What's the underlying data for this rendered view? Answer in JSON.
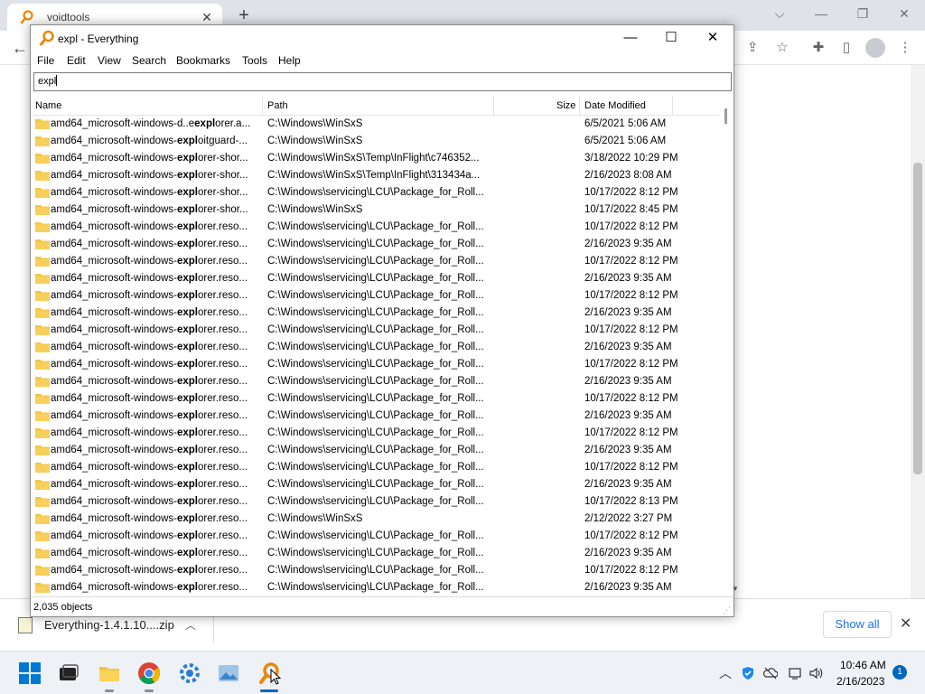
{
  "browser": {
    "tab_title": "voidtools",
    "tab_close": "✕",
    "new_tab": "+",
    "window_controls": {
      "dropdown": "⌵",
      "minimize": "—",
      "restore": "❐",
      "close": "✕"
    },
    "back": "←",
    "toolbar_icons": {
      "share": "⇪",
      "star": "☆",
      "puzzle": "✚",
      "sidebar": "▯",
      "menu": "⋮"
    }
  },
  "download_bar": {
    "file_name": "Everything-1.4.1.10....zip",
    "chevron": "︿",
    "show_all": "Show all",
    "close": "✕"
  },
  "everything": {
    "title": "expl - Everything",
    "controls": {
      "minimize": "—",
      "maximize": "☐",
      "close": "✕"
    },
    "menu": [
      "File",
      "Edit",
      "View",
      "Search",
      "Bookmarks",
      "Tools",
      "Help"
    ],
    "search_value": "expl",
    "columns": {
      "name": "Name",
      "path": "Path",
      "size": "Size",
      "date": "Date Modified"
    },
    "rows": [
      {
        "name_pre": "amd64_microsoft-windows-d..e",
        "name_hl": "expl",
        "name_post": "orer.a...",
        "path": "C:\\Windows\\WinSxS",
        "date": "6/5/2021 5:06 AM"
      },
      {
        "name_pre": "amd64_microsoft-windows-",
        "name_hl": "expl",
        "name_post": "oitguard-...",
        "path": "C:\\Windows\\WinSxS",
        "date": "6/5/2021 5:06 AM"
      },
      {
        "name_pre": "amd64_microsoft-windows-",
        "name_hl": "expl",
        "name_post": "orer-shor...",
        "path": "C:\\Windows\\WinSxS\\Temp\\InFlight\\c746352...",
        "date": "3/18/2022 10:29 PM"
      },
      {
        "name_pre": "amd64_microsoft-windows-",
        "name_hl": "expl",
        "name_post": "orer-shor...",
        "path": "C:\\Windows\\WinSxS\\Temp\\InFlight\\313434a...",
        "date": "2/16/2023 8:08 AM"
      },
      {
        "name_pre": "amd64_microsoft-windows-",
        "name_hl": "expl",
        "name_post": "orer-shor...",
        "path": "C:\\Windows\\servicing\\LCU\\Package_for_Roll...",
        "date": "10/17/2022 8:12 PM"
      },
      {
        "name_pre": "amd64_microsoft-windows-",
        "name_hl": "expl",
        "name_post": "orer-shor...",
        "path": "C:\\Windows\\WinSxS",
        "date": "10/17/2022 8:45 PM"
      },
      {
        "name_pre": "amd64_microsoft-windows-",
        "name_hl": "expl",
        "name_post": "orer.reso...",
        "path": "C:\\Windows\\servicing\\LCU\\Package_for_Roll...",
        "date": "10/17/2022 8:12 PM"
      },
      {
        "name_pre": "amd64_microsoft-windows-",
        "name_hl": "expl",
        "name_post": "orer.reso...",
        "path": "C:\\Windows\\servicing\\LCU\\Package_for_Roll...",
        "date": "2/16/2023 9:35 AM"
      },
      {
        "name_pre": "amd64_microsoft-windows-",
        "name_hl": "expl",
        "name_post": "orer.reso...",
        "path": "C:\\Windows\\servicing\\LCU\\Package_for_Roll...",
        "date": "10/17/2022 8:12 PM"
      },
      {
        "name_pre": "amd64_microsoft-windows-",
        "name_hl": "expl",
        "name_post": "orer.reso...",
        "path": "C:\\Windows\\servicing\\LCU\\Package_for_Roll...",
        "date": "2/16/2023 9:35 AM"
      },
      {
        "name_pre": "amd64_microsoft-windows-",
        "name_hl": "expl",
        "name_post": "orer.reso...",
        "path": "C:\\Windows\\servicing\\LCU\\Package_for_Roll...",
        "date": "10/17/2022 8:12 PM"
      },
      {
        "name_pre": "amd64_microsoft-windows-",
        "name_hl": "expl",
        "name_post": "orer.reso...",
        "path": "C:\\Windows\\servicing\\LCU\\Package_for_Roll...",
        "date": "2/16/2023 9:35 AM"
      },
      {
        "name_pre": "amd64_microsoft-windows-",
        "name_hl": "expl",
        "name_post": "orer.reso...",
        "path": "C:\\Windows\\servicing\\LCU\\Package_for_Roll...",
        "date": "10/17/2022 8:12 PM"
      },
      {
        "name_pre": "amd64_microsoft-windows-",
        "name_hl": "expl",
        "name_post": "orer.reso...",
        "path": "C:\\Windows\\servicing\\LCU\\Package_for_Roll...",
        "date": "2/16/2023 9:35 AM"
      },
      {
        "name_pre": "amd64_microsoft-windows-",
        "name_hl": "expl",
        "name_post": "orer.reso...",
        "path": "C:\\Windows\\servicing\\LCU\\Package_for_Roll...",
        "date": "10/17/2022 8:12 PM"
      },
      {
        "name_pre": "amd64_microsoft-windows-",
        "name_hl": "expl",
        "name_post": "orer.reso...",
        "path": "C:\\Windows\\servicing\\LCU\\Package_for_Roll...",
        "date": "2/16/2023 9:35 AM"
      },
      {
        "name_pre": "amd64_microsoft-windows-",
        "name_hl": "expl",
        "name_post": "orer.reso...",
        "path": "C:\\Windows\\servicing\\LCU\\Package_for_Roll...",
        "date": "10/17/2022 8:12 PM"
      },
      {
        "name_pre": "amd64_microsoft-windows-",
        "name_hl": "expl",
        "name_post": "orer.reso...",
        "path": "C:\\Windows\\servicing\\LCU\\Package_for_Roll...",
        "date": "2/16/2023 9:35 AM"
      },
      {
        "name_pre": "amd64_microsoft-windows-",
        "name_hl": "expl",
        "name_post": "orer.reso...",
        "path": "C:\\Windows\\servicing\\LCU\\Package_for_Roll...",
        "date": "10/17/2022 8:12 PM"
      },
      {
        "name_pre": "amd64_microsoft-windows-",
        "name_hl": "expl",
        "name_post": "orer.reso...",
        "path": "C:\\Windows\\servicing\\LCU\\Package_for_Roll...",
        "date": "2/16/2023 9:35 AM"
      },
      {
        "name_pre": "amd64_microsoft-windows-",
        "name_hl": "expl",
        "name_post": "orer.reso...",
        "path": "C:\\Windows\\servicing\\LCU\\Package_for_Roll...",
        "date": "10/17/2022 8:12 PM"
      },
      {
        "name_pre": "amd64_microsoft-windows-",
        "name_hl": "expl",
        "name_post": "orer.reso...",
        "path": "C:\\Windows\\servicing\\LCU\\Package_for_Roll...",
        "date": "2/16/2023 9:35 AM"
      },
      {
        "name_pre": "amd64_microsoft-windows-",
        "name_hl": "expl",
        "name_post": "orer.reso...",
        "path": "C:\\Windows\\servicing\\LCU\\Package_for_Roll...",
        "date": "10/17/2022 8:13 PM"
      },
      {
        "name_pre": "amd64_microsoft-windows-",
        "name_hl": "expl",
        "name_post": "orer.reso...",
        "path": "C:\\Windows\\WinSxS",
        "date": "2/12/2022 3:27 PM"
      },
      {
        "name_pre": "amd64_microsoft-windows-",
        "name_hl": "expl",
        "name_post": "orer.reso...",
        "path": "C:\\Windows\\servicing\\LCU\\Package_for_Roll...",
        "date": "10/17/2022 8:12 PM"
      },
      {
        "name_pre": "amd64_microsoft-windows-",
        "name_hl": "expl",
        "name_post": "orer.reso...",
        "path": "C:\\Windows\\servicing\\LCU\\Package_for_Roll...",
        "date": "2/16/2023 9:35 AM"
      },
      {
        "name_pre": "amd64_microsoft-windows-",
        "name_hl": "expl",
        "name_post": "orer.reso...",
        "path": "C:\\Windows\\servicing\\LCU\\Package_for_Roll...",
        "date": "10/17/2022 8:12 PM"
      },
      {
        "name_pre": "amd64_microsoft-windows-",
        "name_hl": "expl",
        "name_post": "orer.reso...",
        "path": "C:\\Windows\\servicing\\LCU\\Package_for_Roll...",
        "date": "2/16/2023 9:35 AM"
      }
    ],
    "status": "2,035 objects"
  },
  "taskbar": {
    "apps": [
      "start-icon",
      "task-view-icon",
      "file-explorer-icon",
      "chrome-icon",
      "settings-icon",
      "photos-icon",
      "everything-icon"
    ],
    "tray_chevron": "︿",
    "time": "10:46 AM",
    "date": "2/16/2023",
    "notification_count": "1"
  },
  "colors": {
    "folder": "#f4c542",
    "accent": "#0067c0",
    "everything_logo": "#e8890c"
  }
}
